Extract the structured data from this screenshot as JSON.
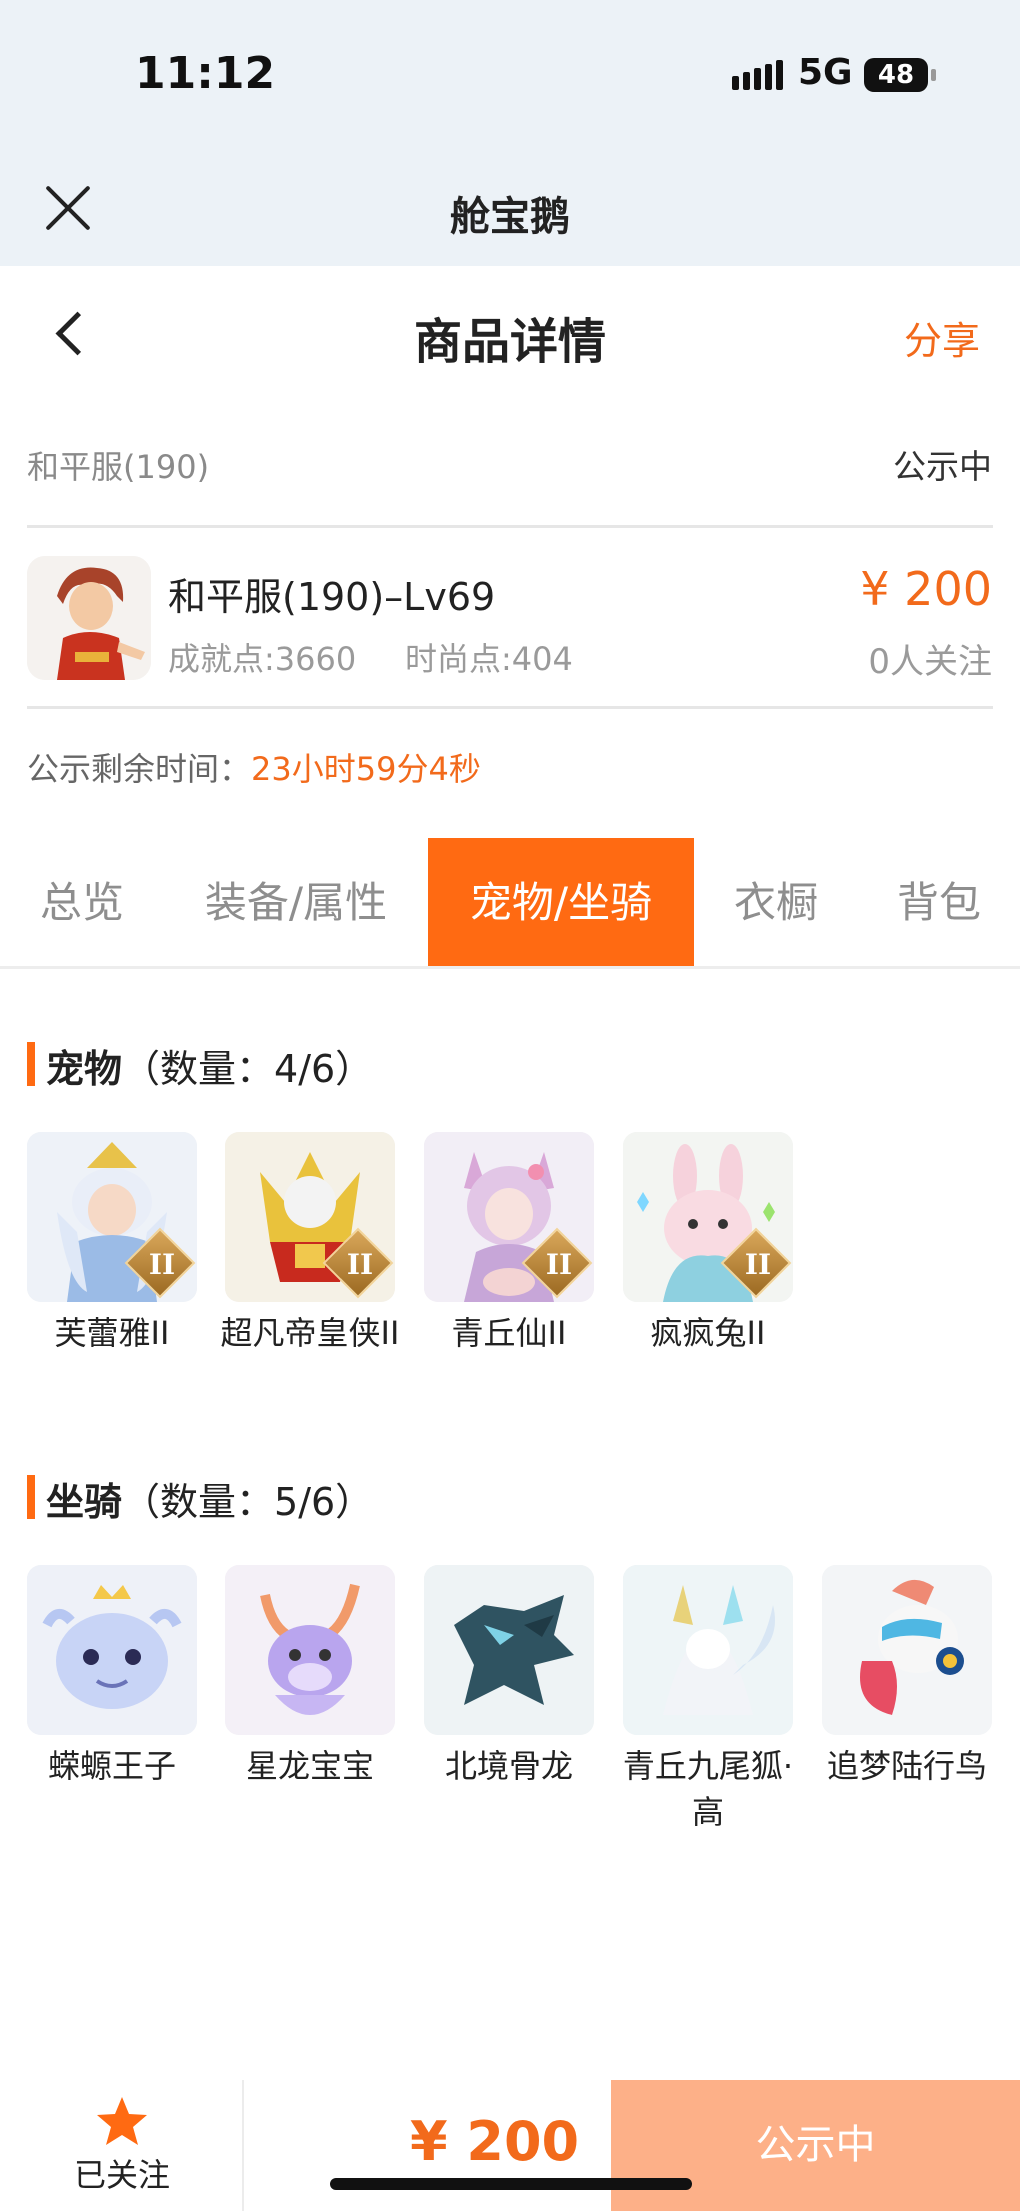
{
  "status_bar": {
    "time": "11:12",
    "network": "5G",
    "battery": "48"
  },
  "mini_app": {
    "title": "舱宝鹅"
  },
  "header": {
    "title": "商品详情",
    "share": "分享"
  },
  "listing": {
    "server": "和平服(190)",
    "status": "公示中",
    "character_name": "和平服(190)–Lv69",
    "achievement": "成就点:3660",
    "fashion": "时尚点:404",
    "price": "¥ 200",
    "followers": "0人关注",
    "remaining_label": "公示剩余时间：",
    "remaining_value": "23小时59分4秒"
  },
  "tabs": [
    {
      "label": "总览"
    },
    {
      "label": "装备/属性"
    },
    {
      "label": "宠物/坐骑",
      "active": true
    },
    {
      "label": "衣橱"
    },
    {
      "label": "背包"
    }
  ],
  "pets": {
    "title": "宠物",
    "count": "（数量：4/6）",
    "items": [
      {
        "name": "芙蕾雅II",
        "rank": "II",
        "icon": "fairy-pet-icon"
      },
      {
        "name": "超凡帝皇侠II",
        "rank": "II",
        "icon": "golden-armor-pet-icon"
      },
      {
        "name": "青丘仙II",
        "rank": "II",
        "icon": "fox-fairy-pet-icon"
      },
      {
        "name": "疯疯兔II",
        "rank": "II",
        "icon": "rabbit-pet-icon"
      }
    ]
  },
  "mounts": {
    "title": "坐骑",
    "count": "（数量：5/6）",
    "items": [
      {
        "name": "蝾螈王子",
        "icon": "axolotl-mount-icon"
      },
      {
        "name": "星龙宝宝",
        "icon": "baby-dragon-mount-icon"
      },
      {
        "name": "北境骨龙",
        "icon": "bone-dragon-mount-icon"
      },
      {
        "name": "青丘九尾狐·高",
        "icon": "nine-tail-fox-mount-icon"
      },
      {
        "name": "追梦陆行鸟",
        "icon": "dream-bird-mount-icon"
      }
    ]
  },
  "bottom_bar": {
    "follow_label": "已关注",
    "price": "¥ 200",
    "action": "公示中"
  },
  "colors": {
    "accent": "#ff6a12",
    "price": "#f26a1b",
    "action_button": "#fdb088"
  }
}
